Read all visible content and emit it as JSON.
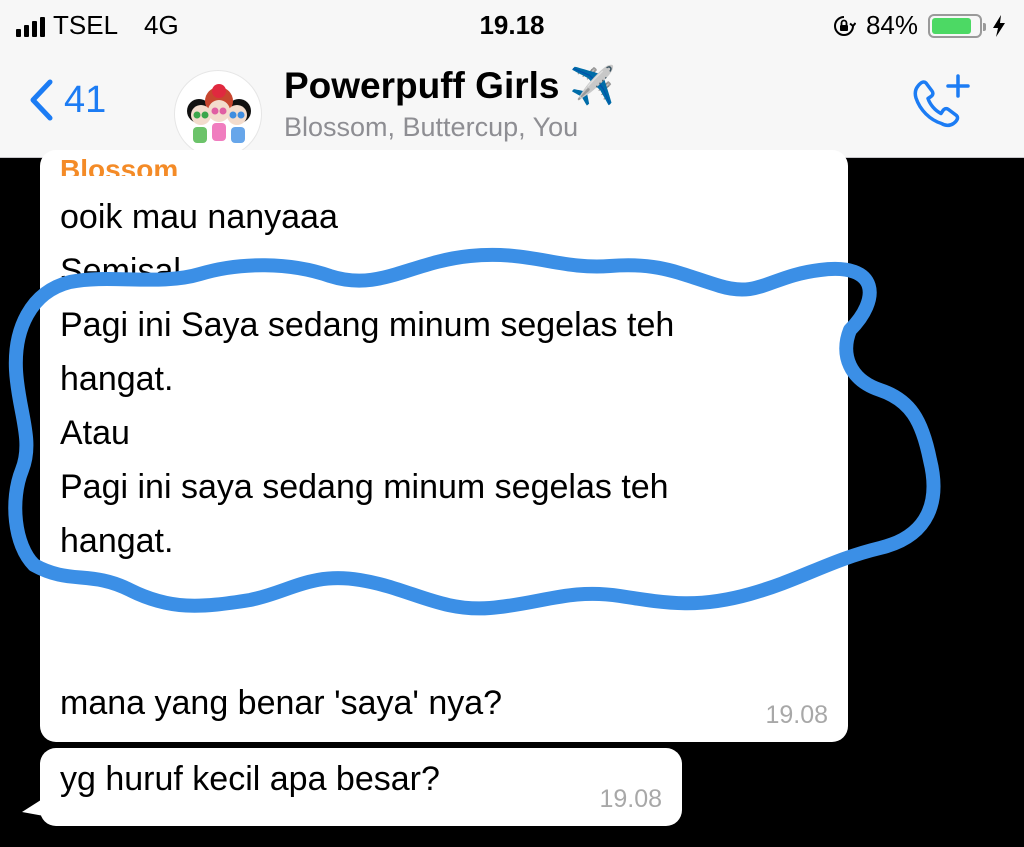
{
  "status_bar": {
    "carrier": "TSEL",
    "network": "4G",
    "time": "19.18",
    "battery_percent": "84%",
    "battery_level": 0.84,
    "icons": [
      "signal-icon",
      "orientation-lock-icon",
      "battery-icon",
      "charging-bolt-icon"
    ]
  },
  "nav": {
    "back_count": "41",
    "title": "Powerpuff Girls",
    "title_emoji": "✈️",
    "subtitle": "Blossom, Buttercup, You",
    "accent_color": "#1c7cf4"
  },
  "messages": [
    {
      "sender": "Blossom",
      "sender_color": "#f48b27",
      "lines": [
        "ooik mau nanyaaa",
        "Semisal",
        "Pagi ini Saya sedang minum segelas teh",
        "hangat.",
        "Atau",
        "Pagi ini saya sedang minum segelas teh",
        "hangat.",
        "",
        "",
        "mana yang benar 'saya' nya?"
      ],
      "time": "19.08"
    },
    {
      "text": "yg huruf kecil apa besar?",
      "time": "19.08"
    }
  ],
  "annotation": {
    "color": "#3b8fe6",
    "icon": "hand-drawn-circle"
  }
}
